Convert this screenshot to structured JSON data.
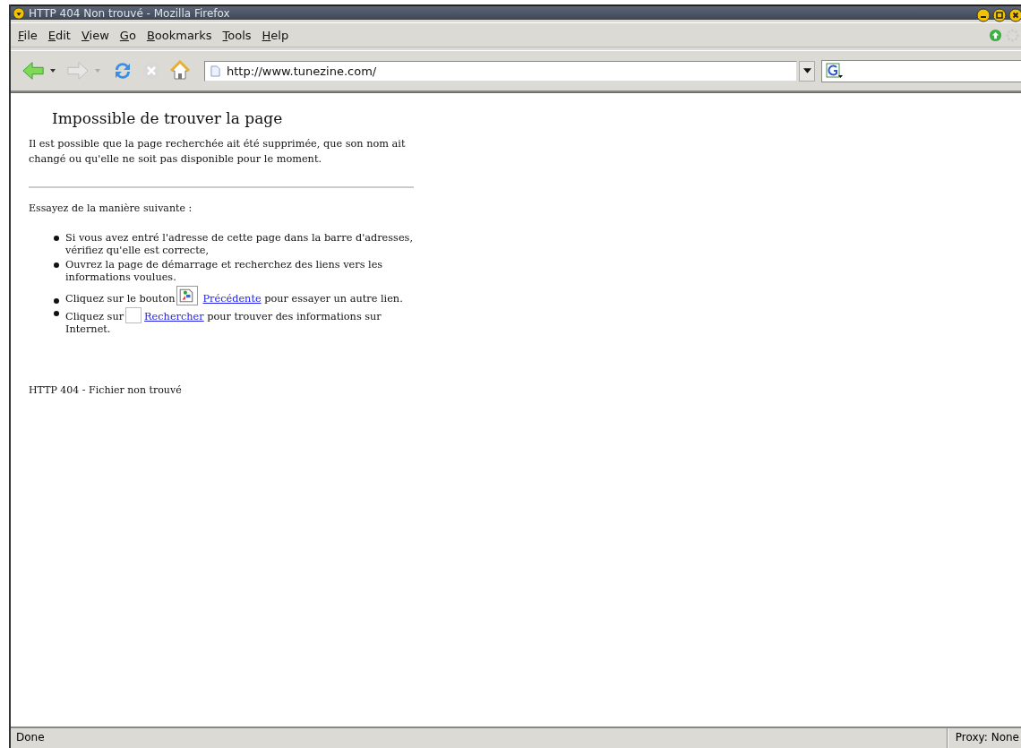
{
  "window": {
    "title": "HTTP 404 Non trouvé - Mozilla Firefox"
  },
  "menu": [
    "File",
    "Edit",
    "View",
    "Go",
    "Bookmarks",
    "Tools",
    "Help"
  ],
  "address_bar": {
    "value": "http://www.tunezine.com/"
  },
  "page": {
    "heading": "Impossible de trouver la page",
    "intro": "Il est possible que la page recherchée ait été supprimée, que son nom ait changé ou qu'elle ne soit pas disponible pour le moment.",
    "try_label": "Essayez de la manière suivante :",
    "items": [
      {
        "text": "Si vous avez entré l'adresse de cette page dans la barre d'adresses, vérifiez qu'elle est correcte,"
      },
      {
        "text": "Ouvrez la page de démarrage et recherchez des liens vers les informations voulues."
      },
      {
        "text": "Cliquez sur le bouton",
        "kind": "image",
        "link": "Précédente",
        "after": "pour essayer un autre lien."
      },
      {
        "text": "Cliquez sur",
        "kind": "blank",
        "link": "Rechercher",
        "after": "pour trouver des informations sur Internet."
      }
    ],
    "footer": "HTTP 404 - Fichier non trouvé"
  },
  "status_bar": {
    "status": "Done",
    "proxy": "Proxy: None"
  }
}
